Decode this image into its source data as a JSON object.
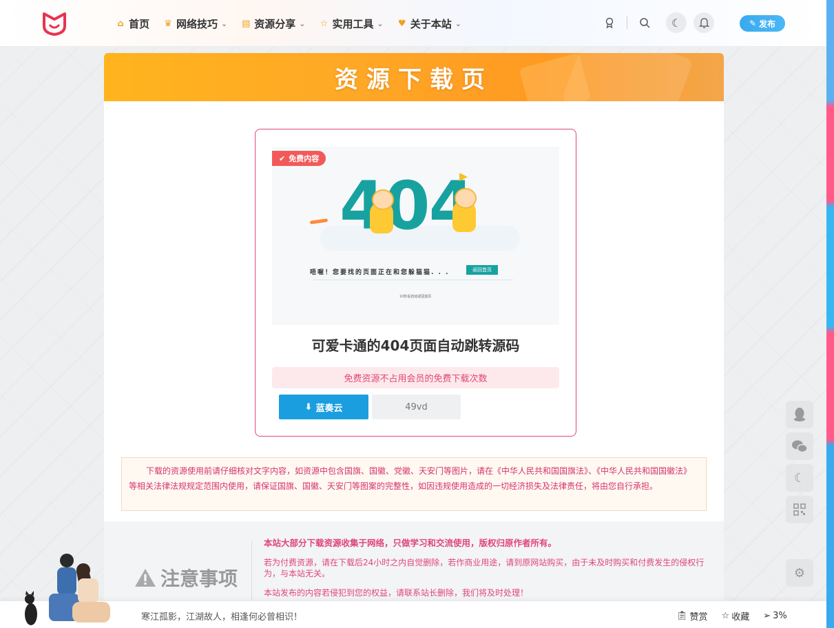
{
  "header": {
    "nav": [
      {
        "icon": "home-icon",
        "label": "首页"
      },
      {
        "icon": "crown-icon",
        "label": "网络技巧"
      },
      {
        "icon": "book-icon",
        "label": "资源分享"
      },
      {
        "icon": "star-icon",
        "label": "实用工具"
      },
      {
        "icon": "heart-icon",
        "label": "关于本站"
      }
    ],
    "publish_label": "发布"
  },
  "banner": {
    "title": "资源下载页"
  },
  "resource": {
    "badge": "免费内容",
    "preview": {
      "big_text": "404",
      "message": "唔喔！您要找的页面正在和您躲猫猫. . .",
      "button": "返回首页",
      "foot": "10秒后自动返回首页"
    },
    "title": "可爱卡通的404页面自动跳转源码",
    "free_note": "免费资源不占用会员的免费下载次数",
    "download_label": "蓝奏云",
    "code": "49vd"
  },
  "legal": "下载的资源使用前请仔细核对文字内容，如资源中包含国旗、国徽、党徽、天安门等图片，请在《中华人民共和国国旗法》、《中华人民共和国国徽法》等相关法律法规规定范围内使用，请保证国旗、国徽、天安门等图案的完整性，如因违规使用造成的一切经济损失及法律责任，将由您自行承担。",
  "notice": {
    "heading": "注意事项",
    "lead": "本站大部分下载资源收集于网络，只做学习和交流使用，版权归原作者所有。",
    "p1": "若为付费资源，请在下载后24小时之内自觉删除，若作商业用途，请到原网站购买，由于未及时购买和付费发生的侵权行为，与本站无关。",
    "p2": "本站发布的内容若侵犯到您的权益，请联系站长删除，我们将及时处理！"
  },
  "footer": {
    "quote": "寒江孤影，江湖故人，相逢何必曾相识！",
    "reward": "赞赏",
    "favorite": "收藏",
    "progress": "3%"
  },
  "colors": {
    "accent_pink": "#e0457b",
    "accent_blue": "#1a9ee0",
    "banner_orange": "#ffa826",
    "teal_404": "#17a2a0"
  }
}
